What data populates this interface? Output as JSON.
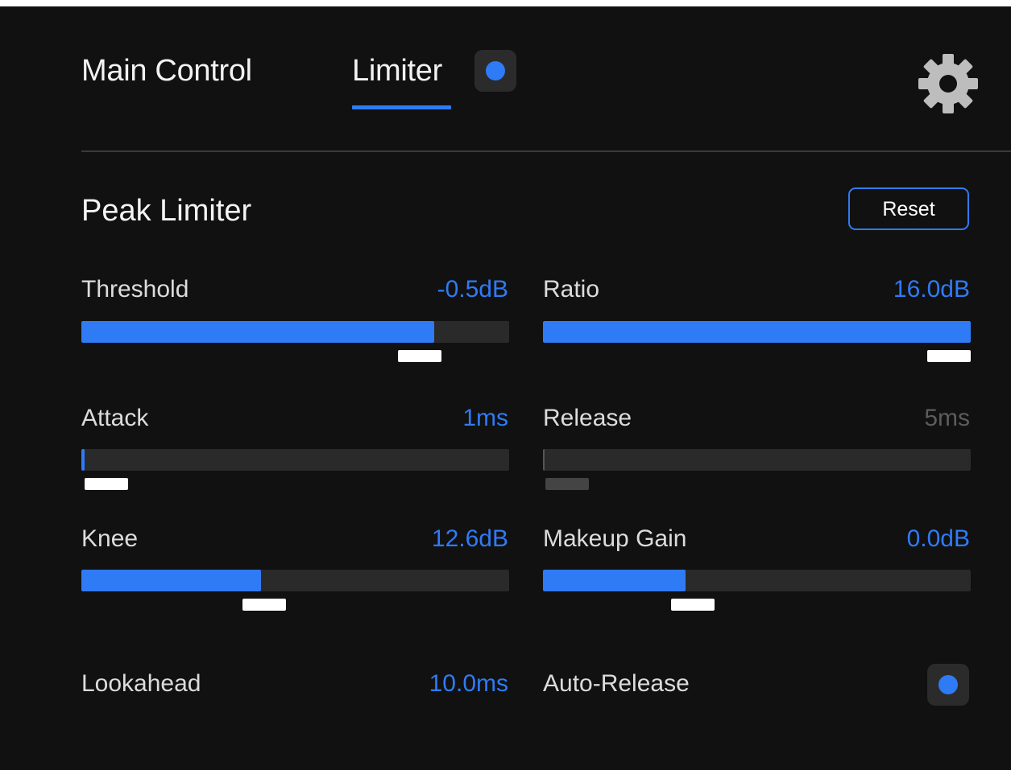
{
  "tabs": {
    "main_label": "Main Control",
    "limiter_label": "Limiter"
  },
  "section": {
    "title": "Peak Limiter",
    "reset_label": "Reset"
  },
  "params": {
    "threshold": {
      "label": "Threshold",
      "value": "-0.5dB",
      "level": 0.825,
      "enabled": true
    },
    "ratio": {
      "label": "Ratio",
      "value": "16.0dB",
      "level": 1.0,
      "enabled": true
    },
    "attack": {
      "label": "Attack",
      "value": "1ms",
      "level": 0.008,
      "enabled": true
    },
    "release": {
      "label": "Release",
      "value": "5ms",
      "level": 0.004,
      "enabled": false
    },
    "knee": {
      "label": "Knee",
      "value": "12.6dB",
      "level": 0.42,
      "enabled": true
    },
    "makeup_gain": {
      "label": "Makeup Gain",
      "value": "0.0dB",
      "level": 0.333,
      "enabled": true
    },
    "lookahead": {
      "label": "Lookahead",
      "value": "10.0ms"
    },
    "auto_release": {
      "label": "Auto-Release",
      "on": true
    }
  },
  "colors": {
    "accent": "#2f7bf5",
    "background": "#111111",
    "track": "#2a2a2a",
    "disabled_text": "#5c5c5c"
  },
  "icons": {
    "settings": "gear-icon",
    "toggle_dot": "toggle-dot-icon"
  }
}
